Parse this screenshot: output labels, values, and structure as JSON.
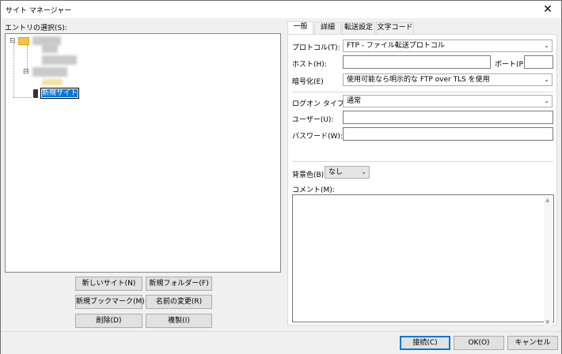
{
  "window": {
    "title": "サイト マネージャー",
    "close_glyph": "✕"
  },
  "left": {
    "entry_label": "エントリの選択(S):",
    "tree": {
      "expand_glyph": "⊟",
      "editing_label": "新規サイト"
    },
    "buttons": {
      "new_site": "新しいサイト(N)",
      "new_folder": "新規フォルダー(F)",
      "new_bookmark": "新規ブックマーク(M)",
      "rename": "名前の変更(R)",
      "delete": "削除(D)",
      "duplicate": "複製(I)"
    }
  },
  "tabs": [
    "一般",
    "詳細",
    "転送設定",
    "文字コード"
  ],
  "general": {
    "protocol_label": "プロトコル(T):",
    "protocol_value": "FTP - ファイル転送プロトコル",
    "host_label": "ホスト(H):",
    "host_value": "",
    "port_label": "ポート(P):",
    "port_value": "",
    "encryption_label": "暗号化(E)",
    "encryption_value": "使用可能なら明示的な FTP over TLS を使用",
    "logon_label": "ログオン タイプ(L):",
    "logon_value": "通常",
    "user_label": "ユーザー(U):",
    "user_value": "",
    "password_label": "パスワード(W):",
    "password_value": "",
    "bgcolor_label": "背景色(B):",
    "bgcolor_value": "なし",
    "comment_label": "コメント(M):",
    "comment_value": ""
  },
  "footer": {
    "connect": "接続(C)",
    "ok": "OK(O)",
    "cancel": "キャンセル"
  }
}
